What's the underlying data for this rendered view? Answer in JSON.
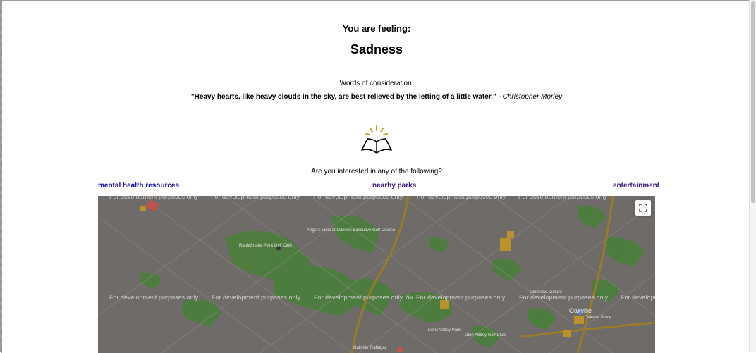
{
  "header": {
    "feeling_label": "You are feeling:",
    "emotion": "Sadness"
  },
  "consideration": {
    "label": "Words of consideration:",
    "quote": "\"Heavy hearts, like heavy clouds in the sky, are best relieved by the letting of a little water.\"",
    "separator": " - ",
    "author": "Christopher Morley"
  },
  "icon": {
    "name": "open-book-icon",
    "rays_color": "#c79a1e"
  },
  "interests": {
    "question": "Are you interested in any of the following?",
    "links": {
      "mental_health": "mental health resources",
      "parks": "nearby parks",
      "entertainment": "entertainment"
    }
  },
  "map": {
    "watermark": "For development purposes only",
    "labels": {
      "angels_view": "Angel's View at Oakville Executive Golf Course",
      "rattlesnake": "RattleSnake Point Golf Club",
      "oakville": "Oakville",
      "oakville_place": "Oakville Place",
      "glen_abbey": "Glen Abbey Golf Club",
      "lions_valley": "Lions Valley Park",
      "oakville_trafalgar": "Oakville Trafalgar",
      "glenview": "Glenview Culture",
      "north": "Nor"
    },
    "fullscreen_icon": "fullscreen-icon",
    "colors": {
      "base": "#6e6b68",
      "park": "#4a7f3a",
      "highway": "#9a7b2a",
      "poi": "#b9922b",
      "hospital": "#c0534f"
    }
  }
}
